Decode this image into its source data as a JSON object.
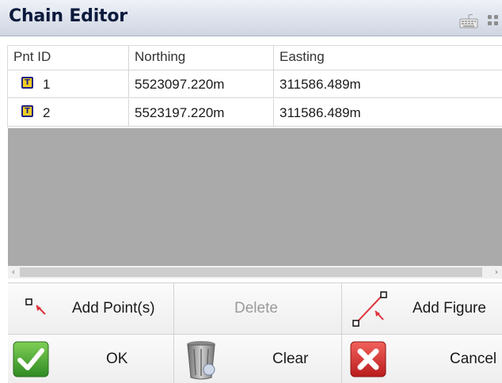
{
  "window": {
    "title": "Chain Editor"
  },
  "icons": {
    "keyboard": "keyboard-icon",
    "grip": "grip-icon"
  },
  "table": {
    "columns": [
      "Pnt ID",
      "Northing",
      "Easting"
    ],
    "rows": [
      {
        "badge": "T",
        "id": "1",
        "northing": "5523097.220m",
        "easting": "311586.489m"
      },
      {
        "badge": "T",
        "id": "2",
        "northing": "5523197.220m",
        "easting": "311586.489m"
      }
    ]
  },
  "scrollbar": {
    "left_arrow": "‹",
    "right_arrow": "›"
  },
  "buttons": {
    "add_points": "Add Point(s)",
    "delete": "Delete",
    "add_figure": "Add Figure",
    "ok": "OK",
    "clear": "Clear",
    "cancel": "Cancel"
  },
  "colors": {
    "title_text": "#0b1a3c",
    "badge_fill": "#f1cf21",
    "badge_border": "#232086",
    "empty_area": "#abaaab",
    "ok_green": "#3e9e2c",
    "cancel_red": "#d42a26",
    "pointer_red": "#e0303a"
  }
}
